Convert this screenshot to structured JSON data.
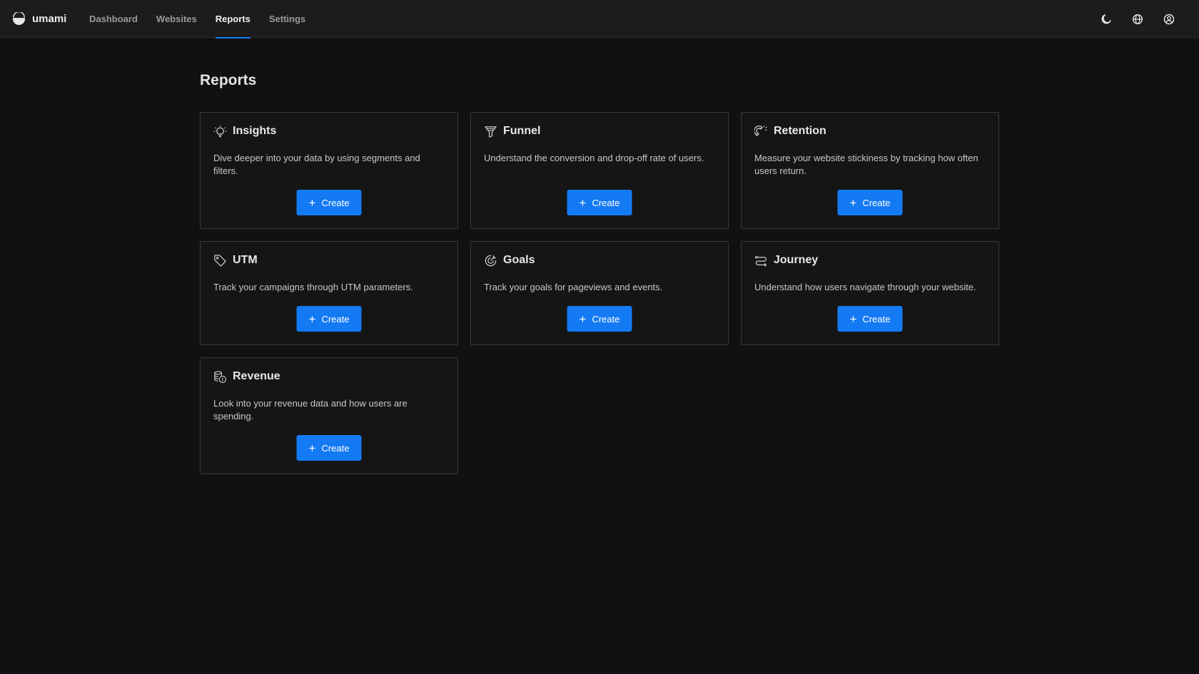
{
  "app": {
    "name": "umami"
  },
  "nav": {
    "items": [
      {
        "label": "Dashboard",
        "active": false
      },
      {
        "label": "Websites",
        "active": false
      },
      {
        "label": "Reports",
        "active": true
      },
      {
        "label": "Settings",
        "active": false
      }
    ]
  },
  "top_actions": {
    "theme_icon": "moon-icon",
    "language_icon": "globe-icon",
    "profile_icon": "user-circle-icon"
  },
  "page": {
    "title": "Reports"
  },
  "colors": {
    "accent": "#147af3",
    "background": "#111111",
    "topbar": "#1c1c1c",
    "card_border": "#3a3a3a"
  },
  "reports": [
    {
      "title": "Insights",
      "icon": "lightbulb-icon",
      "description": "Dive deeper into your data by using segments and filters.",
      "button": "Create"
    },
    {
      "title": "Funnel",
      "icon": "funnel-icon",
      "description": "Understand the conversion and drop-off rate of users.",
      "button": "Create"
    },
    {
      "title": "Retention",
      "icon": "magnet-icon",
      "description": "Measure your website stickiness by tracking how often users return.",
      "button": "Create"
    },
    {
      "title": "UTM",
      "icon": "tag-icon",
      "description": "Track your campaigns through UTM parameters.",
      "button": "Create"
    },
    {
      "title": "Goals",
      "icon": "target-icon",
      "description": "Track your goals for pageviews and events.",
      "button": "Create"
    },
    {
      "title": "Journey",
      "icon": "route-icon",
      "description": "Understand how users navigate through your website.",
      "button": "Create"
    },
    {
      "title": "Revenue",
      "icon": "coins-icon",
      "description": "Look into your revenue data and how users are spending.",
      "button": "Create"
    }
  ]
}
